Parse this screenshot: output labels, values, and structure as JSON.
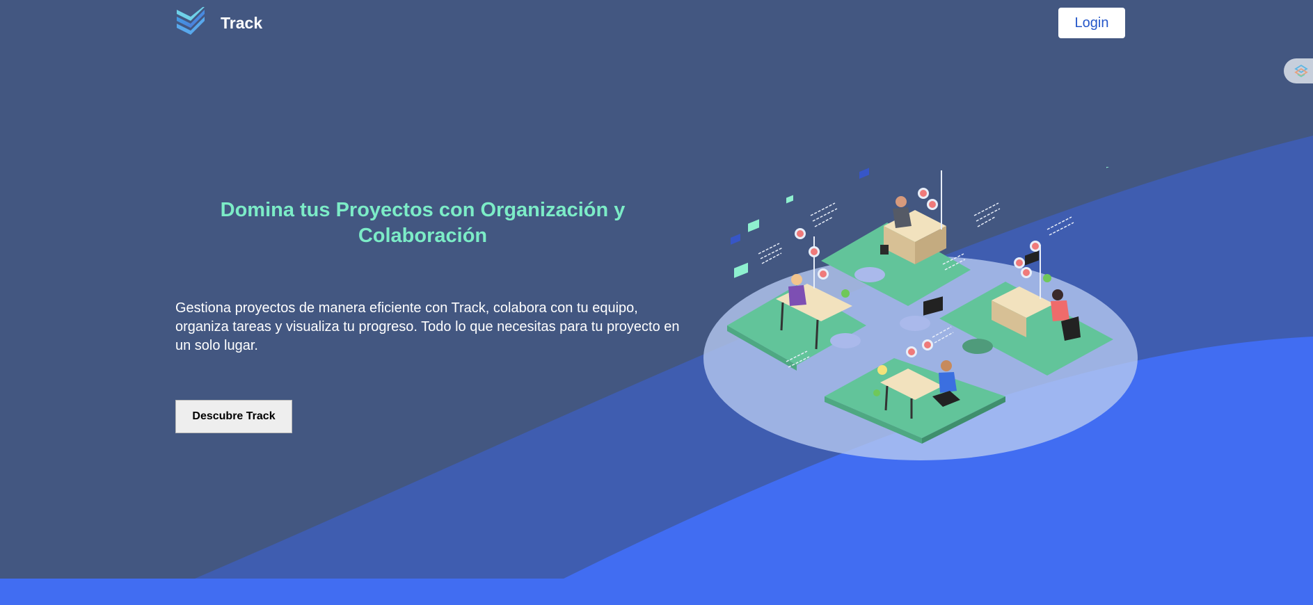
{
  "header": {
    "brand_name": "Track",
    "login_label": "Login"
  },
  "hero": {
    "title": "Domina tus Proyectos con Organización y Colaboración",
    "description": "Gestiona proyectos de manera eficiente con Track, colabora con tu equipo, organiza tareas y visualiza tu progreso. Todo lo que necesitas para tu proyecto en un solo lugar.",
    "cta_label": "Descubre Track"
  },
  "icons": {
    "logo": "stacked-chevrons-logo-icon",
    "side_widget": "layered-shapes-icon"
  },
  "colors": {
    "background": "#435781",
    "wave_mid": "#3f5db0",
    "wave_front": "#416df2",
    "accent_title": "#7cecc7",
    "login_text": "#2557c9",
    "puzzle_green": "#62c49a"
  }
}
